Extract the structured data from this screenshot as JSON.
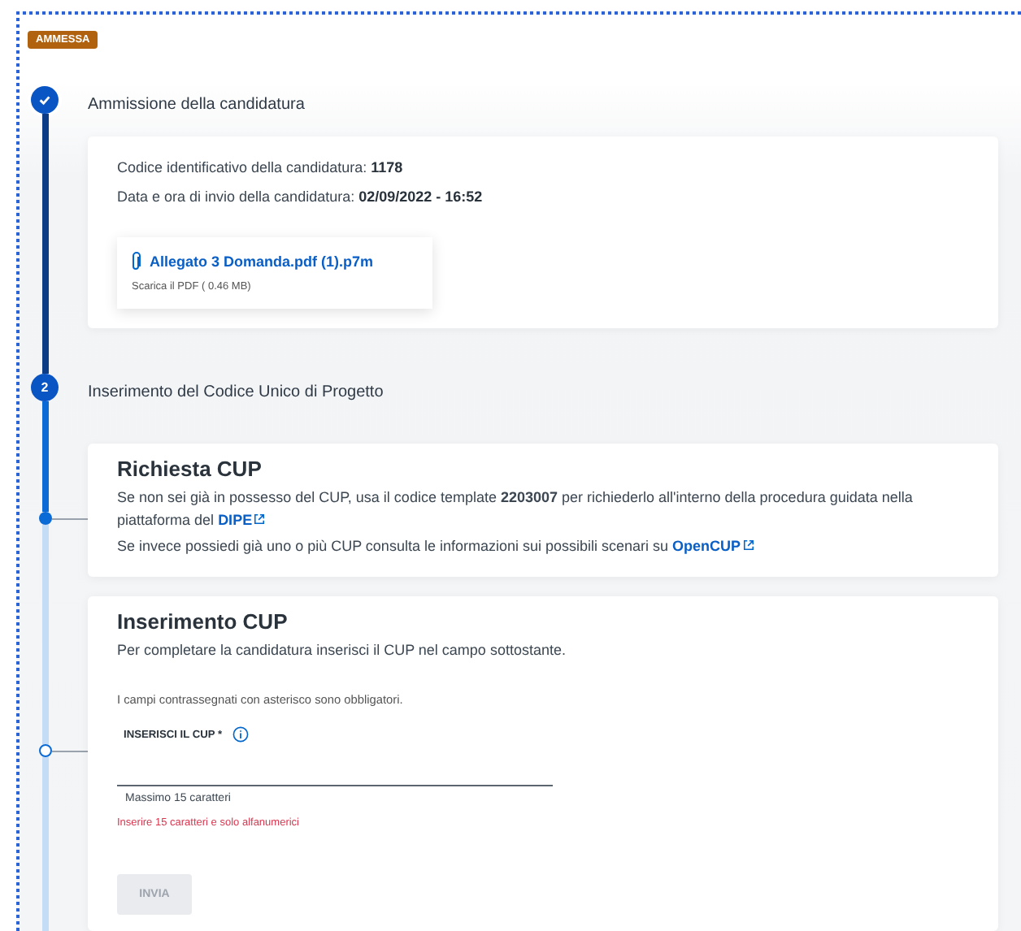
{
  "status_badge": "AMMESSA",
  "steps": [
    {
      "completed": true,
      "title": "Ammissione della candidatura",
      "details": [
        {
          "label": "Codice identificativo della candidatura:",
          "value": "1178"
        },
        {
          "label": "Data e ora di invio della candidatura:",
          "value": "02/09/2022 - 16:52"
        }
      ],
      "attachment": {
        "name": "Allegato 3 Domanda.pdf (1).p7m",
        "caption": "Scarica il PDF ( 0.46 MB)"
      }
    },
    {
      "completed": false,
      "number": "2",
      "title": "Inserimento del Codice Unico di Progetto",
      "substeps": [
        {
          "completed": true,
          "kind": "info",
          "title": "Richiesta CUP",
          "paragraphs": [
            {
              "text": "Se non sei già in possesso del CUP, usa il codice template **2203007** per richiederlo all'interno della procedura guidata nella piattaforma del",
              "link": "DIPE"
            },
            {
              "text": "Se invece possiedi già uno o più CUP consulta le informazioni sui possibili scenari su",
              "link": "OpenCUP"
            }
          ]
        },
        {
          "completed": false,
          "kind": "form",
          "title": "Inserimento CUP",
          "intro": "Per completare la candidatura inserisci il CUP nel campo sottostante.",
          "required_note": "I campi contrassegnati con asterisco sono obbligatori.",
          "field": {
            "label": "INSERISCI IL CUP *",
            "helper": "Massimo 15 caratteri",
            "error": "Inserire 15 caratteri e solo alfanumerici"
          },
          "submit": {
            "label": "INVIA",
            "disabled": true
          }
        }
      ]
    }
  ]
}
